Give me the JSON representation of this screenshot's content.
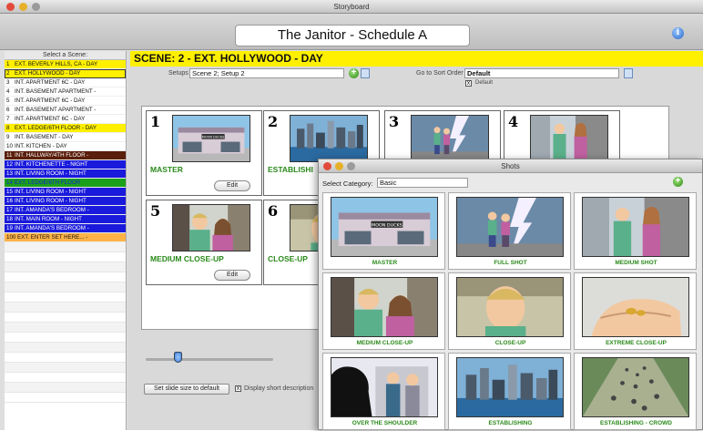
{
  "window": {
    "title": "Storyboard",
    "doc_title": "The Janitor - Schedule A"
  },
  "colors": {
    "accent_yellow": "#fff000",
    "caption_green": "#2a8a1a",
    "scene_blue": "#1a1adc",
    "scene_brown": "#5a1e0a",
    "scene_green": "#1aa01a",
    "scene_orange": "#ffb347"
  },
  "sidebar": {
    "header": "Select a Scene:",
    "scenes": [
      {
        "n": "1",
        "label": "EXT. BEVERLY HILLS, CA  - DAY",
        "bg": "#fff000",
        "fg": "#111"
      },
      {
        "n": "2",
        "label": "EXT. HOLLYWOOD  - DAY",
        "bg": "#fff000",
        "fg": "#111"
      },
      {
        "n": "3",
        "label": "INT. APARTMENT 6C  - DAY",
        "bg": "#ffffff",
        "fg": "#111"
      },
      {
        "n": "4",
        "label": "INT. BASEMENT APARTMENT  -",
        "bg": "#ffffff",
        "fg": "#111"
      },
      {
        "n": "5",
        "label": "INT. APARTMENT 6C  - DAY",
        "bg": "#ffffff",
        "fg": "#111"
      },
      {
        "n": "6",
        "label": "INT. BASEMENT APARTMENT  -",
        "bg": "#ffffff",
        "fg": "#111"
      },
      {
        "n": "7",
        "label": "INT. APARTMENT 6C  - DAY",
        "bg": "#ffffff",
        "fg": "#111"
      },
      {
        "n": "8",
        "label": "EXT. LEDGE/6TH FLOOR  - DAY",
        "bg": "#fff000",
        "fg": "#111"
      },
      {
        "n": "9",
        "label": "INT. BASEMENT  - DAY",
        "bg": "#ffffff",
        "fg": "#111"
      },
      {
        "n": "10",
        "label": "INT. KITCHEN  - DAY",
        "bg": "#ffffff",
        "fg": "#111"
      },
      {
        "n": "11",
        "label": "INT. HALLWAY/4TH FLOOR  -",
        "bg": "#5a1e0a",
        "fg": "#ffffff"
      },
      {
        "n": "12",
        "label": "INT. KITCHENETTE  - NIGHT",
        "bg": "#1a1adc",
        "fg": "#ffffff"
      },
      {
        "n": "13",
        "label": "INT. LIVING ROOM  - NIGHT",
        "bg": "#1a1adc",
        "fg": "#ffffff"
      },
      {
        "n": "14",
        "label": "EXT. LEDGE/6TH FLOOR",
        "bg": "#1aa01a",
        "fg": "#1a1adc"
      },
      {
        "n": "15",
        "label": "INT. LIVING ROOM  - NIGHT",
        "bg": "#1a1adc",
        "fg": "#ffffff"
      },
      {
        "n": "16",
        "label": "INT. LIVING ROOM  - NIGHT",
        "bg": "#1a1adc",
        "fg": "#ffffff"
      },
      {
        "n": "17",
        "label": "INT. AMANDA'S BEDROOM  -",
        "bg": "#1a1adc",
        "fg": "#ffffff"
      },
      {
        "n": "18",
        "label": "INT. MAIN ROOM  - NIGHT",
        "bg": "#1a1adc",
        "fg": "#ffffff"
      },
      {
        "n": "19",
        "label": "INT. AMANDA'S BEDROOM  -",
        "bg": "#1a1adc",
        "fg": "#ffffff"
      },
      {
        "n": "100",
        "label": "EXT. ENTER SET HERE...  -",
        "bg": "#ffb347",
        "fg": "#111"
      }
    ]
  },
  "scene": {
    "title": "SCENE: 2 - EXT. HOLLYWOOD  - DAY",
    "setups_label": "Setups",
    "setups_value": "Scene 2; Setup 2",
    "sort_label": "Go to Sort Order",
    "sort_value": "Default",
    "default_check_label": "Default"
  },
  "cards": [
    {
      "num": "1",
      "caption": "MASTER",
      "edit": "Edit",
      "art": "building"
    },
    {
      "num": "2",
      "caption": "ESTABLISHI",
      "edit": "",
      "art": "city"
    },
    {
      "num": "3",
      "caption": "",
      "edit": "",
      "art": "fullshot"
    },
    {
      "num": "4",
      "caption": "",
      "edit": "",
      "art": "medium"
    },
    {
      "num": "5",
      "caption": "MEDIUM CLOSE-UP",
      "edit": "Edit",
      "art": "mcu"
    },
    {
      "num": "6",
      "caption": "CLOSE-UP",
      "edit": "",
      "art": "cu"
    }
  ],
  "bottom": {
    "slide_button": "Set slide size to default",
    "display_desc": "Display short description"
  },
  "slider": {
    "value": 0.25
  },
  "shots_window": {
    "title": "Shots",
    "category_label": "Select Category:",
    "category_value": "Basic",
    "shots": [
      {
        "caption": "MASTER",
        "art": "building"
      },
      {
        "caption": "FULL SHOT",
        "art": "fullshot"
      },
      {
        "caption": "MEDIUM SHOT",
        "art": "medium"
      },
      {
        "caption": "MEDIUM CLOSE-UP",
        "art": "mcu"
      },
      {
        "caption": "CLOSE-UP",
        "art": "cu"
      },
      {
        "caption": "EXTREME CLOSE-UP",
        "art": "ecu"
      },
      {
        "caption": "OVER THE SHOULDER",
        "art": "ots"
      },
      {
        "caption": "ESTABLISHING",
        "art": "city"
      },
      {
        "caption": "ESTABLISHING - CROWD",
        "art": "crowd"
      }
    ]
  },
  "icons": {
    "info": "info-icon",
    "add": "plus-icon",
    "sort": "sort-icon",
    "close": "close-icon"
  }
}
